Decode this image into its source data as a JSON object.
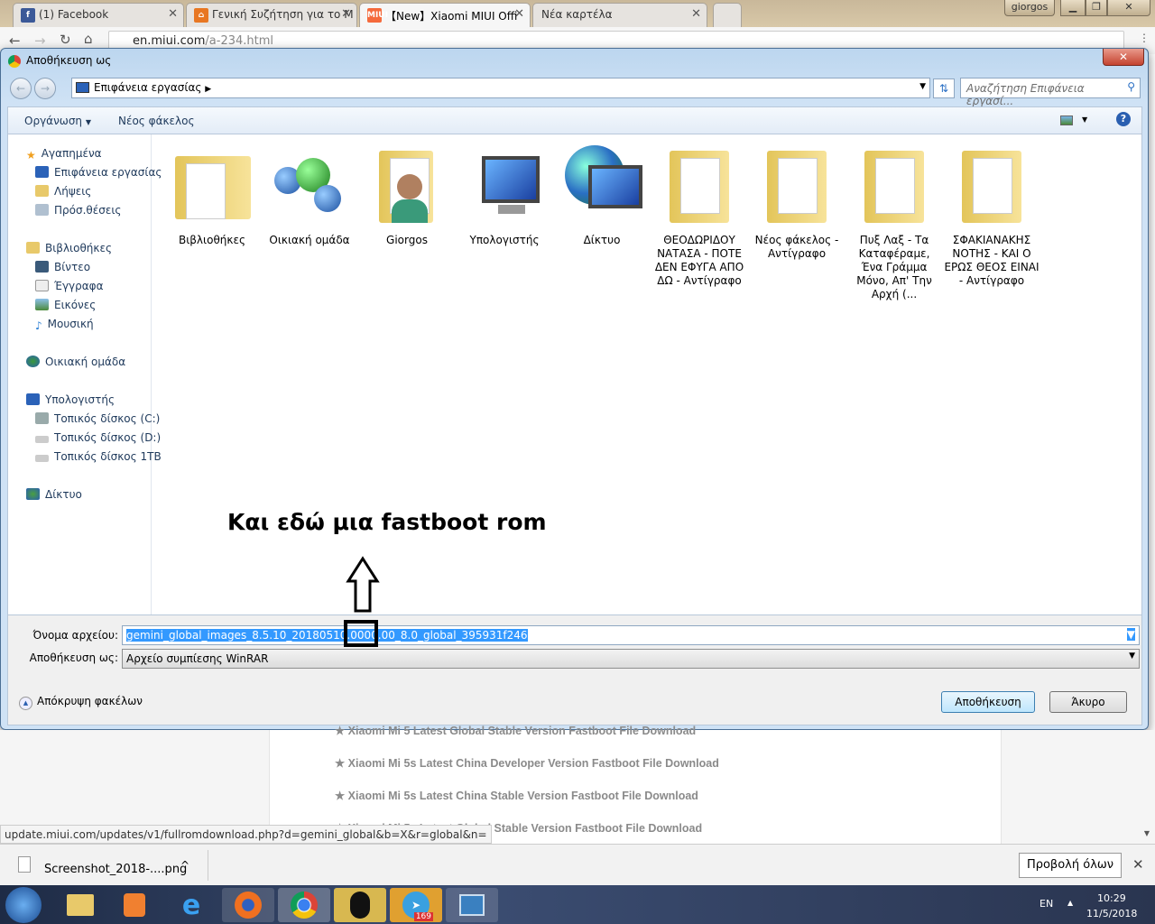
{
  "browser": {
    "tabs": [
      {
        "label": "(1) Facebook",
        "icon": "facebook-icon",
        "color": "#3b5998"
      },
      {
        "label": "Γενική Συζήτηση για το M",
        "icon": "forum-icon",
        "color": "#e87722"
      },
      {
        "label": "【New】Xiaomi MIUI Offi",
        "icon": "miui-icon",
        "color": "#f56a3c",
        "favicon_text": "MIUI"
      },
      {
        "label": "Νέα καρτέλα",
        "icon": "new-tab-icon"
      }
    ],
    "profile": "giorgos",
    "url_host": "en.miui.com",
    "url_path": "/a-234.html"
  },
  "dialog": {
    "title": "Αποθήκευση ως",
    "location": "Επιφάνεια εργασίας",
    "search_placeholder": "Αναζήτηση Επιφάνεια εργασί...",
    "organize": "Οργάνωση",
    "new_folder": "Νέος φάκελος",
    "nav": {
      "favorites": "Αγαπημένα",
      "desktop": "Επιφάνεια εργασίας",
      "downloads": "Λήψεις",
      "recent": "Πρόσ.θέσεις",
      "libraries": "Βιβλιοθήκες",
      "videos": "Βίντεο",
      "documents": "Έγγραφα",
      "pictures": "Εικόνες",
      "music": "Μουσική",
      "homegroup": "Οικιακή ομάδα",
      "computer": "Υπολογιστής",
      "drive_c": "Τοπικός δίσκος (C:)",
      "drive_d": "Τοπικός δίσκος  (D:)",
      "drive_1tb": "Τοπικός δίσκος 1TB",
      "network": "Δίκτυο"
    },
    "items": [
      "Βιβλιοθήκες",
      "Οικιακή ομάδα",
      "Giorgos",
      "Υπολογιστής",
      "Δίκτυο",
      "ΘΕΟΔΩΡΙΔΟΥ ΝΑΤΑΣΑ - ΠΟΤΕ ΔΕΝ ΕΦΥΓΑ ΑΠΟ ΔΩ - Αντίγραφο",
      "Νέος φάκελος - Αντίγραφο",
      "Πυξ Λαξ - Τα Καταφέραμε, Ένα Γράμμα Μόνο, Απ' Την Αρχή (...",
      "ΣΦΑΚΙΑΝΑΚΗΣ ΝΟΤΗΣ - ΚΑΙ Ο ΕΡΩΣ ΘΕΟΣ ΕΙΝΑΙ - Αντίγραφο"
    ],
    "filename_label": "Όνομα αρχείου:",
    "filename": "gemini_global_images_8.5.10_20180510.0000.00_8.0_global_395931f246",
    "savetype_label": "Αποθήκευση ως:",
    "savetype": "Αρχείο συμπίεσης WinRAR",
    "hide_folders": "Απόκρυψη φακέλων",
    "save": "Αποθήκευση",
    "cancel": "Άκυρο"
  },
  "annotation": "Και εδώ μια fastboot rom",
  "page": {
    "links": [
      "★ Xiaomi Mi 5 Latest Global Stable Version Fastboot File Download",
      "★ Xiaomi Mi 5s Latest China Developer Version Fastboot File Download",
      "★ Xiaomi Mi 5s Latest China Stable Version Fastboot File Download",
      "★ Xiaomi Mi 5s Latest Global Stable Version Fastboot File Download"
    ],
    "status_url": "update.miui.com/updates/v1/fullromdownload.php?d=gemini_global&b=X&r=global&n="
  },
  "downloads": {
    "file": "Screenshot_2018-....png",
    "show_all": "Προβολή όλων"
  },
  "taskbar": {
    "lang": "EN",
    "time": "10:29",
    "date": "11/5/2018",
    "telegram_badge": "169"
  }
}
